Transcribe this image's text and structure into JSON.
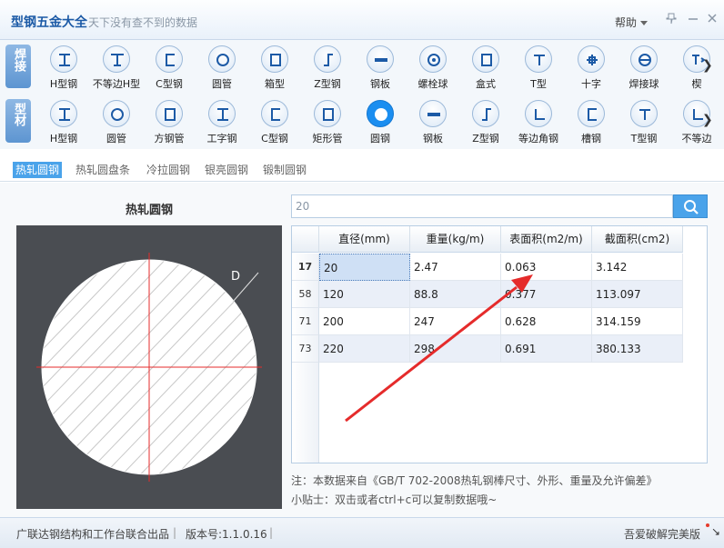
{
  "app": {
    "title": "型钢五金大全",
    "slogan": "天下没有查不到的数据",
    "help": "帮助",
    "pin_icon": "pin-icon",
    "minimize_icon": "minimize-icon",
    "close_icon": "close-icon"
  },
  "categories": [
    {
      "label": "焊接",
      "items": [
        {
          "label": "H型钢",
          "icon": "h-beam-icon"
        },
        {
          "label": "不等边H型",
          "icon": "unequal-h-beam-icon"
        },
        {
          "label": "C型钢",
          "icon": "c-channel-icon"
        },
        {
          "label": "圆管",
          "icon": "round-pipe-icon"
        },
        {
          "label": "箱型",
          "icon": "box-section-icon"
        },
        {
          "label": "Z型钢",
          "icon": "z-section-icon"
        },
        {
          "label": "钢板",
          "icon": "steel-plate-icon"
        },
        {
          "label": "螺栓球",
          "icon": "bolt-ball-icon"
        },
        {
          "label": "盒式",
          "icon": "box-type-icon"
        },
        {
          "label": "T型",
          "icon": "t-section-icon"
        },
        {
          "label": "十字",
          "icon": "cross-section-icon"
        },
        {
          "label": "焊接球",
          "icon": "welded-ball-icon"
        },
        {
          "label": "楔",
          "icon": "wedge-icon"
        }
      ]
    },
    {
      "label": "型材",
      "items": [
        {
          "label": "H型钢",
          "icon": "h-beam-icon"
        },
        {
          "label": "圆管",
          "icon": "round-pipe-icon"
        },
        {
          "label": "方钢管",
          "icon": "square-tube-icon"
        },
        {
          "label": "工字钢",
          "icon": "i-beam-icon"
        },
        {
          "label": "C型钢",
          "icon": "c-channel-icon"
        },
        {
          "label": "矩形管",
          "icon": "rect-tube-icon"
        },
        {
          "label": "圆钢",
          "icon": "round-bar-icon"
        },
        {
          "label": "钢板",
          "icon": "steel-plate-icon"
        },
        {
          "label": "Z型钢",
          "icon": "z-section-icon"
        },
        {
          "label": "等边角钢",
          "icon": "equal-angle-icon"
        },
        {
          "label": "槽钢",
          "icon": "channel-icon"
        },
        {
          "label": "T型钢",
          "icon": "t-section-icon"
        },
        {
          "label": "不等边",
          "icon": "unequal-angle-icon"
        }
      ]
    }
  ],
  "subtabs": [
    "热轧圆钢",
    "热轧圆盘条",
    "冷拉圆钢",
    "银亮圆钢",
    "锻制圆钢"
  ],
  "section": {
    "title": "热轧圆钢",
    "diagram_label": "D"
  },
  "search": {
    "value": "20",
    "icon": "search-icon"
  },
  "table": {
    "columns": [
      "直径(mm)",
      "重量(kg/m)",
      "表面积(m2/m)",
      "截面积(cm2)"
    ],
    "rows": [
      {
        "num": "17",
        "cells": [
          "20",
          "2.47",
          "0.063",
          "3.142"
        ]
      },
      {
        "num": "58",
        "cells": [
          "120",
          "88.8",
          "0.377",
          "113.097"
        ]
      },
      {
        "num": "71",
        "cells": [
          "200",
          "247",
          "0.628",
          "314.159"
        ]
      },
      {
        "num": "73",
        "cells": [
          "220",
          "298",
          "0.691",
          "380.133"
        ]
      }
    ]
  },
  "notes": [
    "注：本数据来自《GB/T 702-2008热轧钢棒尺寸、外形、重量及允许偏差》",
    "小贴士：双击或者ctrl+c可以复制数据哦~"
  ],
  "status": {
    "left": "广联达钢结构和工作台联合出品",
    "version": "版本号:1.1.0.16",
    "right": "吾爱破解完美版"
  },
  "colors": {
    "accent": "#4aa3ea",
    "active_icon": "#1b8ef0",
    "arrow": "#e52b2b"
  }
}
